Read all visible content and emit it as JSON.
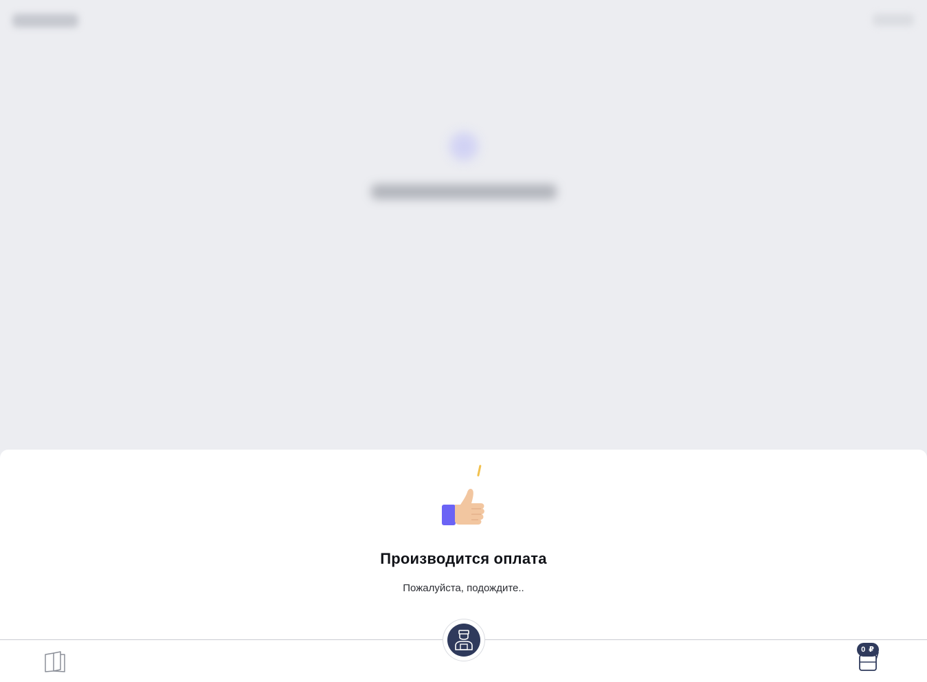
{
  "sheet": {
    "title": "Производится оплата",
    "subtitle": "Пожалуйста, подождите.."
  },
  "bottom_nav": {
    "left_icon": "book-icon",
    "center_icon": "courier-icon",
    "right_icon": "wallet-icon",
    "wallet_balance": "0 ₽"
  },
  "colors": {
    "background": "#ecedf1",
    "sheet": "#ffffff",
    "nav_accent": "#2f3a5c",
    "thumb_sleeve": "#6b63f5",
    "thumb_skin": "#f2c6a0",
    "coin": "#f2c14e"
  }
}
